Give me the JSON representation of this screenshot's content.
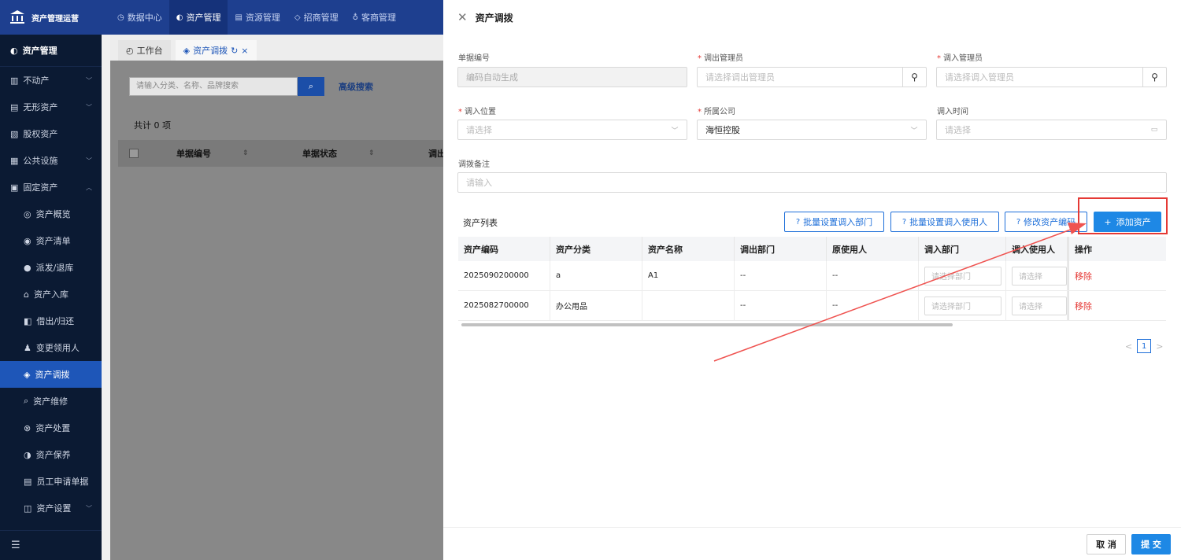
{
  "app": {
    "title": "资产管理运营"
  },
  "topnav": [
    {
      "icon": "◷",
      "label": "数据中心"
    },
    {
      "icon": "◐",
      "label": "资产管理"
    },
    {
      "icon": "▤",
      "label": "资源管理"
    },
    {
      "icon": "◇",
      "label": "招商管理"
    },
    {
      "icon": "♁",
      "label": "客商管理"
    }
  ],
  "sidebar": {
    "header": "资产管理",
    "items": [
      {
        "icon": "▥",
        "label": "不动产",
        "chevron": "﹀"
      },
      {
        "icon": "▤",
        "label": "无形资产",
        "chevron": "﹀"
      },
      {
        "icon": "▧",
        "label": "股权资产",
        "chevron": ""
      },
      {
        "icon": "▦",
        "label": "公共设施",
        "chevron": "﹀"
      },
      {
        "icon": "▣",
        "label": "固定资产",
        "chevron": "︿"
      }
    ],
    "subitems": [
      {
        "icon": "◎",
        "label": "资产概览"
      },
      {
        "icon": "◉",
        "label": "资产清单"
      },
      {
        "icon": "●",
        "label": "派发/退库"
      },
      {
        "icon": "⌂",
        "label": "资产入库"
      },
      {
        "icon": "◧",
        "label": "借出/归还"
      },
      {
        "icon": "♟",
        "label": "变更领用人"
      },
      {
        "icon": "◈",
        "label": "资产调拨"
      },
      {
        "icon": "⌕",
        "label": "资产维修"
      },
      {
        "icon": "⊗",
        "label": "资产处置"
      },
      {
        "icon": "◑",
        "label": "资产保养"
      },
      {
        "icon": "▤",
        "label": "员工申请单据"
      },
      {
        "icon": "◫",
        "label": "资产设置",
        "chevron": "﹀"
      }
    ],
    "footer_icon": "☰"
  },
  "tabs": [
    {
      "icon": "◴",
      "label": "工作台"
    },
    {
      "icon": "◈",
      "label": "资产调拨",
      "refresh": "↻",
      "close": "×"
    }
  ],
  "background": {
    "search_placeholder": "请输入分类、名称、品牌搜索",
    "search_icon": "⌕",
    "advanced_search": "高级搜索",
    "count": "共计 0 项",
    "columns": [
      "单据编号",
      "单据状态",
      "调出"
    ],
    "sort_icon": "⇕"
  },
  "drawer": {
    "close_icon": "✕",
    "title": "资产调拨",
    "fields": {
      "doc_no": {
        "label": "单据编号",
        "value": "编码自动生成"
      },
      "out_manager": {
        "label": "调出管理员",
        "placeholder": "请选择调出管理员",
        "icon": "⚲"
      },
      "in_manager": {
        "label": "调入管理员",
        "placeholder": "请选择调入管理员",
        "icon": "⚲"
      },
      "in_location": {
        "label": "调入位置",
        "placeholder": "请选择",
        "icon": "﹀"
      },
      "company": {
        "label": "所属公司",
        "value": "海恒控股",
        "icon": "﹀"
      },
      "in_time": {
        "label": "调入时间",
        "placeholder": "请选择",
        "icon": "▭"
      },
      "remark": {
        "label": "调拨备注",
        "placeholder": "请输入"
      }
    },
    "list_title": "资产列表",
    "buttons": {
      "batch_dept": "批量设置调入部门",
      "batch_user": "批量设置调入使用人",
      "edit_code": "修改资产编码",
      "help_icon": "?",
      "add_asset": "添加资产",
      "add_icon": "+"
    },
    "table": {
      "headers": [
        "资产编码",
        "资产分类",
        "资产名称",
        "调出部门",
        "原使用人",
        "调入部门",
        "调入使用人",
        "操作"
      ],
      "rows": [
        {
          "code": "2025090200000",
          "category": "a",
          "name": "A1",
          "out_dept": "--",
          "orig_user": "--",
          "dept_placeholder": "请选择部门",
          "user_placeholder": "请选择",
          "action": "移除"
        },
        {
          "code": "2025082700000",
          "category": "办公用品",
          "name": "",
          "out_dept": "--",
          "orig_user": "--",
          "dept_placeholder": "请选择部门",
          "user_placeholder": "请选择",
          "action": "移除"
        }
      ]
    },
    "pager": {
      "prev": "<",
      "page": "1",
      "next": ">"
    },
    "footer": {
      "cancel": "取 消",
      "submit": "提 交"
    }
  },
  "colors": {
    "primary": "#1e88e5",
    "topbar": "#1e3f8f",
    "sidebar": "#0b1a33",
    "danger": "#e53935",
    "annotation": "#ef5350"
  }
}
